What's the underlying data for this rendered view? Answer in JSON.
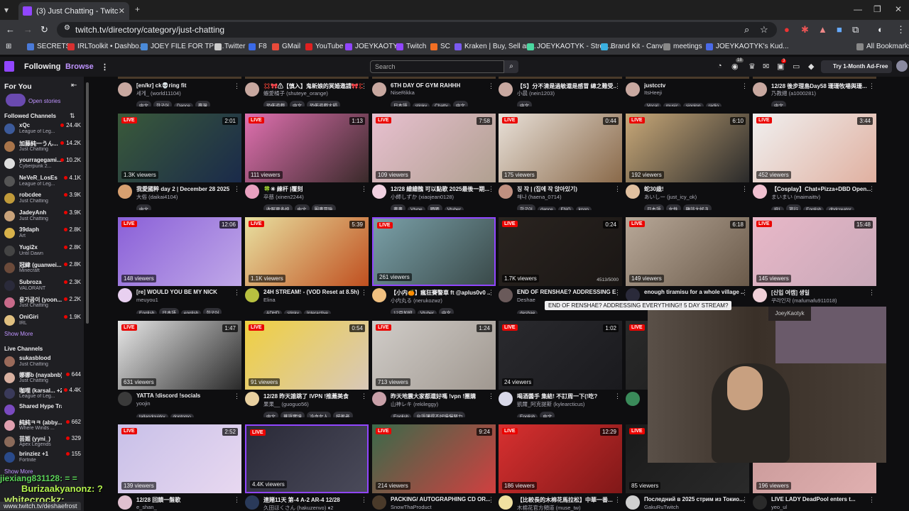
{
  "browser": {
    "tab_title": "(3) Just Chatting - Twitch",
    "url": "twitch.tv/directory/category/just-chatting",
    "bookmarks": [
      "SECRETS",
      "IRLToolkit • Dashbo...",
      "JOEY FILE FOR TP -...",
      "Twitter",
      "F8",
      "GMail",
      "YouTube",
      "JOEYKAOTYK",
      "Twitch",
      "SC",
      "Kraken | Buy, Sell an...",
      "JOEYKAOTYK - Strea...",
      "Brand Kit - Canva",
      "meetings",
      "JOEYKAOTYK's Kud...",
      "All Bookmarks"
    ],
    "status_url": "www.twitch.tv/deshaefrost"
  },
  "header": {
    "following": "Following",
    "browse": "Browse",
    "search_placeholder": "Search",
    "turbo": "Try 1-Month Ad-Free",
    "badge_a": "18",
    "badge_b": "3"
  },
  "sidebar": {
    "for_you": "For You",
    "open_stories": "Open stories",
    "followed_heading": "Followed Channels",
    "followed": [
      {
        "name": "xQc",
        "game": "League of Leg...",
        "viewers": "24.4K",
        "color": "#3c5a9a"
      },
      {
        "name": "加藤純一うん...",
        "game": "Just Chatting",
        "viewers": "14.2K",
        "color": "#a8744a"
      },
      {
        "name": "yourragegami...",
        "game": "Cyberpunk 2...",
        "viewers": "10.2K",
        "color": "#ddd"
      },
      {
        "name": "NeVeR_LosEs",
        "game": "League of Leg...",
        "viewers": "4.1K",
        "color": "#555"
      },
      {
        "name": "robcdee",
        "game": "Just Chatting",
        "viewers": "3.9K",
        "color": "#c09a3a"
      },
      {
        "name": "JadeyAnh",
        "game": "Just Chatting",
        "viewers": "3.9K",
        "color": "#c8a27a"
      },
      {
        "name": "39daph",
        "game": "Art",
        "viewers": "2.8K",
        "color": "#d8b24a"
      },
      {
        "name": "Yugi2x",
        "game": "Until Dawn",
        "viewers": "2.8K",
        "color": "#444"
      },
      {
        "name": "冠緯 (guanwei...",
        "game": "Minecraft",
        "viewers": "2.8K",
        "color": "#6b4a3a"
      },
      {
        "name": "Subroza",
        "game": "VALORANT",
        "viewers": "2.3K",
        "color": "#2a2a3a"
      },
      {
        "name": "윤가곰이 (yoon...",
        "game": "Just Chatting",
        "viewers": "2.2K",
        "color": "#c86a8a"
      },
      {
        "name": "OniGiri",
        "game": "IRL",
        "viewers": "1.9K",
        "color": "#e0c080"
      }
    ],
    "show_more": "Show More",
    "live_heading": "Live Channels",
    "live": [
      {
        "name": "sukasblood",
        "game": "Just Chatting",
        "viewers": "",
        "color": "#9a6a5a"
      },
      {
        "name": "娜娜b (nayabnb)",
        "game": "Just Chatting",
        "viewers": "644",
        "color": "#d8b0a0"
      },
      {
        "name": "咖哩 (karsal... +2",
        "game": "League of Leg...",
        "viewers": "4.4K",
        "color": "#3a3a5a"
      },
      {
        "name": "Shared Hype Train ...",
        "game": "",
        "viewers": "",
        "color": "#7a4ac0"
      },
      {
        "name": "純純ㅋㅋ (abby...",
        "game": "Where Winds ...",
        "viewers": "662",
        "color": "#e0a0b0"
      },
      {
        "name": "芸姬 (yyni_)",
        "game": "Apex Legends",
        "viewers": "329",
        "color": "#8a6a5a"
      },
      {
        "name": "brinziez +1",
        "game": "Fortnite",
        "viewers": "155",
        "color": "#2a4a8a"
      }
    ],
    "show_more2": "Show More"
  },
  "top_row": [
    {
      "title": "[en/kr] ck💀ring fit",
      "chan": "세게_ (world11104)",
      "tags": [
        "中文",
        "한국어",
        "Dance",
        "臺灣"
      ]
    },
    {
      "title": "💢🎀⚠【慎入】鬼新娘的冥婚邀請🎀💢",
      "chan": "蝦愛橘子 (shuteye_orange)",
      "tags": [
        "恐佈遊戲",
        "中文",
        "恐佈遊戲大師"
      ]
    },
    {
      "title": "6TH DAY OF GYM RAHHH",
      "chan": "NiseRikka",
      "tags": [
        "日本語",
        "stinky",
        "Chatty",
        "中文"
      ]
    },
    {
      "title": "【S】分不清是過敏還是感冒 總之難受...",
      "chan": "小晨 (nein1203)",
      "tags": [
        "中文"
      ]
    },
    {
      "title": "justcctv",
      "chan": "ItsHeeji",
      "tags": [
        "Vocal",
        "music",
        "singing",
        "radio"
      ]
    },
    {
      "title": "12/28 後步理島Day58 珊珊牧場與珊...",
      "chan": "乃教總 (a1000281)",
      "tags": [
        "中文"
      ]
    }
  ],
  "cards": [
    {
      "dur": "2:01",
      "views": "1.3K viewers",
      "title": "我愛國粹 day 2 | December 28 2025",
      "chan": "大俗 (daikai4104)",
      "tags": [
        "中文"
      ],
      "c1": "#3a5a3a",
      "c2": "#1a2a4a",
      "av": "#d8a070"
    },
    {
      "dur": "1:13",
      "views": "111 viewers",
      "title": "🍀✳ 練杆 |覆刻",
      "chan": "卒慈 (xinen2244)",
      "tags": [
        "收服更多娘",
        "中文",
        "圖畫冒險"
      ],
      "c1": "#e070b0",
      "c2": "#3a2a2a",
      "av": "#e8a0c0"
    },
    {
      "dur": "7:58",
      "views": "109 viewers",
      "title": "12/28 繪繪醜 可以點歌 2025最後一期...",
      "chan": "小師しずか (xiaojean0128)",
      "tags": [
        "畫畫",
        "Vtype",
        "晒晒",
        "Vtuber"
      ],
      "c1": "#e8c0d0",
      "c2": "#b0a090",
      "av": "#f0d0e0"
    },
    {
      "dur": "0:44",
      "views": "175 viewers",
      "title": "징 작 | (집에 작 앉아있기)",
      "chan": "해나 (haena_0714)",
      "tags": [
        "한국어",
        "dance",
        "ENG",
        "kpop"
      ],
      "c1": "#e8e0d8",
      "c2": "#8a6a4a",
      "av": "#c09080"
    },
    {
      "dur": "6:10",
      "views": "192 viewers",
      "title": "蛇30歳!",
      "chan": "あいしー (just_icy_ok)",
      "tags": [
        "日本語",
        "女性",
        "雜談大好き"
      ],
      "c1": "#c8a878",
      "c2": "#2a2a2a",
      "av": "#e0c0a0"
    },
    {
      "dur": "3:44",
      "views": "452 viewers",
      "title": "【Cosplay】Chat+Pizza+DBD Open...",
      "chan": "まいまい (maimaittv)",
      "tags": [
        "IRL",
        "旅行",
        "English",
        "dbdcreator"
      ],
      "c1": "#f0f0f0",
      "c2": "#e0b0a0",
      "av": "#f0c0d0"
    },
    {
      "dur": "12:06",
      "views": "148 viewers",
      "title": "[re] WOULD YOU BE MY NICK",
      "chan": "meuyou1",
      "tags": [
        "English",
        "日本語",
        "english",
        "한국어"
      ],
      "c1": "#8a60d8",
      "c2": "#c0a8e8",
      "av": "#e8d0f0"
    },
    {
      "dur": "5:39",
      "views": "1.1K viewers",
      "title": "24H STREAM! - (VOD Reset at 8.5h)",
      "chan": "Elina",
      "tags": [
        "ADHD",
        "stinky",
        "Interactive"
      ],
      "c1": "#e8e0a0",
      "c2": "#c05020",
      "av": "#b8c040"
    },
    {
      "dur": "",
      "views": "261 viewers",
      "title": "【小内🍊】瘋狂賽警車 ft @aplus0v0 ...",
      "chan": "小内丸る (nerukozwz)",
      "tags": [
        "12月加班",
        "Vtuber",
        "中文"
      ],
      "c1": "#7aa0a8",
      "c2": "#3a4a4a",
      "av": "#f0c080"
    },
    {
      "dur": "0:24",
      "views": "1.7K viewers",
      "title": "END OF RENSHAE? ADDRESSING E...",
      "chan": "Deshae",
      "tags": [
        "deshae"
      ],
      "c1": "#2a2420",
      "c2": "#1a1614",
      "av": "#6a5a5a"
    },
    {
      "dur": "6:18",
      "views": "149 viewers",
      "title": "enough tiramisu for a whole village ...",
      "chan": "",
      "tags": [],
      "c1": "#b8a898",
      "c2": "#6a5a4a",
      "av": "#2a2a3a"
    },
    {
      "dur": "15:48",
      "views": "145 viewers",
      "title": "[신입 여캠] 생일",
      "chan": "쿠라인자 (mafumafu911018)",
      "tags": [],
      "c1": "#e8b8c8",
      "c2": "#c8a8b8",
      "av": "#f0d0d8"
    },
    {
      "dur": "1:47",
      "views": "631 viewers",
      "title": "YATTA !discord !socials",
      "chan": "yoojin",
      "tags": [
        "tallandquirky",
        "dontpmo"
      ],
      "c1": "#e8e8e8",
      "c2": "#2a2a2a",
      "av": "#3a3a3a"
    },
    {
      "dur": "0:54",
      "views": "91 viewers",
      "title": "12/28 昨天誰跳了 IVPN !推薦美食",
      "chan": "果果__ (guoguo56)",
      "tags": [
        "中文",
        "華語實境",
        "冷血女人",
        "技術者"
      ],
      "c1": "#f0d040",
      "c2": "#d8c8b8",
      "av": "#e8d0a0"
    },
    {
      "dur": "1:24",
      "views": "713 viewers",
      "title": "昨天地震大家都還好嗎 !vpn !團購",
      "chan": "山神レキ (rekileggy)",
      "tags": [
        "English",
        "台語講得不好慢慢努力"
      ],
      "c1": "#d0ccc8",
      "c2": "#a09890",
      "av": "#c8a0a8"
    },
    {
      "dur": "1:02",
      "views": "24 viewers",
      "title": "喝酒醬手 集結! 不訂周一下(!吃?",
      "chan": "凱爾_阿克提斯 (kylearcticus)",
      "tags": [
        "English",
        "中文"
      ],
      "c1": "#2a2a2e",
      "c2": "#1a1a1e",
      "av": "#d8d8e8"
    },
    {
      "dur": "",
      "views": "",
      "title": "",
      "chan": "",
      "tags": [],
      "c1": "#2a2a2a",
      "c2": "#1a1a1a",
      "av": "#3a8a5a"
    },
    {
      "dur": "",
      "views": "",
      "title": "",
      "chan": "",
      "tags": [],
      "c1": "#2a2a2a",
      "c2": "#1a1a1a",
      "av": "#2a2a2a"
    },
    {
      "dur": "2:52",
      "views": "139 viewers",
      "title": "12/28 回饋一盤歌",
      "chan": "e_shan_",
      "tags": [],
      "c1": "#c8c0e8",
      "c2": "#e8d8f0",
      "av": "#e0c0d0"
    },
    {
      "dur": "",
      "views": "4.4K viewers",
      "title": "連賭11天 第-4 A-2 AR-4 12/28",
      "chan": "久田ほくさん (hakuzenvo) ♦2",
      "tags": [],
      "c1": "#2a2a38",
      "c2": "#4a4a5a",
      "av": "#2a3a5a"
    },
    {
      "dur": "9:24",
      "views": "214 viewers",
      "title": "PACKING/ AUTOGRAPHING CD OR...",
      "chan": "SnowThaProduct",
      "tags": [],
      "c1": "#3a6a4a",
      "c2": "#d04040",
      "av": "#4a3a2a"
    },
    {
      "dur": "12:29",
      "views": "186 viewers",
      "title": "【比較長的木棉花馬拉松】中華一番...",
      "chan": "木棉花官方頻道 (muse_tw)",
      "tags": [],
      "c1": "#d83030",
      "c2": "#801818",
      "av": "#f0e0a0"
    },
    {
      "dur": "",
      "views": "85 viewers",
      "title": "Последний в 2025 стрим из Токио...",
      "chan": "GakuRuTwitch",
      "tags": [],
      "c1": "#1a1a1a",
      "c2": "#2a2a2a",
      "av": "#d0d0d0"
    },
    {
      "dur": "",
      "views": "196 viewers",
      "title": "LIVE LADY DeadPool enters t...",
      "chan": "yeo_ul",
      "tags": [],
      "c1": "#c89898",
      "c2": "#e0b0b0",
      "av": "#2a2a2a"
    }
  ],
  "tooltip": "END OF RENSHAE? ADDRESSING EVERYTHING!! 5 DAY STREAM?",
  "cam_badge": "JoeyKaotyk",
  "views_counter": "4513/5000",
  "overlay": {
    "line1": "jiexiang831128: = =",
    "line2": "Burizaakyanonz: ?",
    "line3": "whitecrockz:"
  },
  "live_label": "LIVE"
}
